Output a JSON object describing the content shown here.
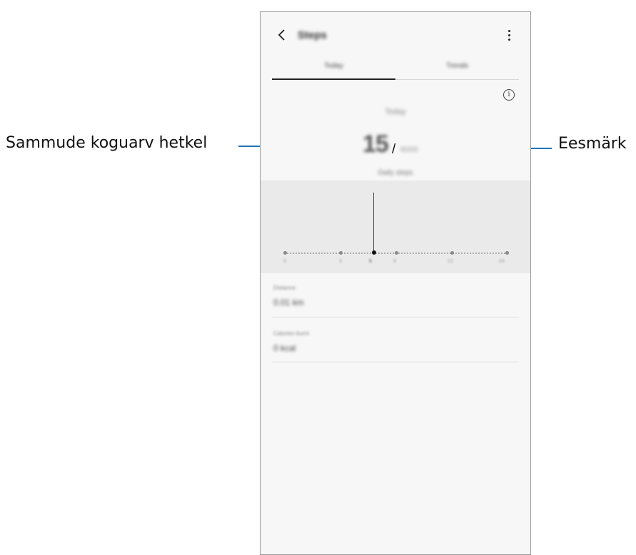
{
  "annotations": {
    "current_steps_label": "Sammude koguarv hetkel",
    "goal_label": "Eesmärk"
  },
  "app": {
    "title": "Steps",
    "tabs": [
      {
        "label": "Today",
        "selected": true
      },
      {
        "label": "Trends",
        "selected": false
      }
    ]
  },
  "summary": {
    "section_label": "Today",
    "current_steps": "15",
    "slash": "/",
    "goal": "6000",
    "subtitle": "Daily steps"
  },
  "chart": {
    "x_ticks": [
      "0",
      "3",
      "6",
      "9",
      "12",
      "24"
    ],
    "selected_tick": "6"
  },
  "stats": [
    {
      "label": "Distance",
      "value": "0.01 km"
    },
    {
      "label": "Calories burnt",
      "value": "0 kcal"
    }
  ],
  "colors": {
    "callout_line": "#1f74b5",
    "screen_background": "#f7f7f7",
    "chart_background": "#eaeaea"
  },
  "icons": {
    "back": "chevron-left-icon",
    "more": "more-vertical-icon",
    "info": "info-circle-icon"
  }
}
